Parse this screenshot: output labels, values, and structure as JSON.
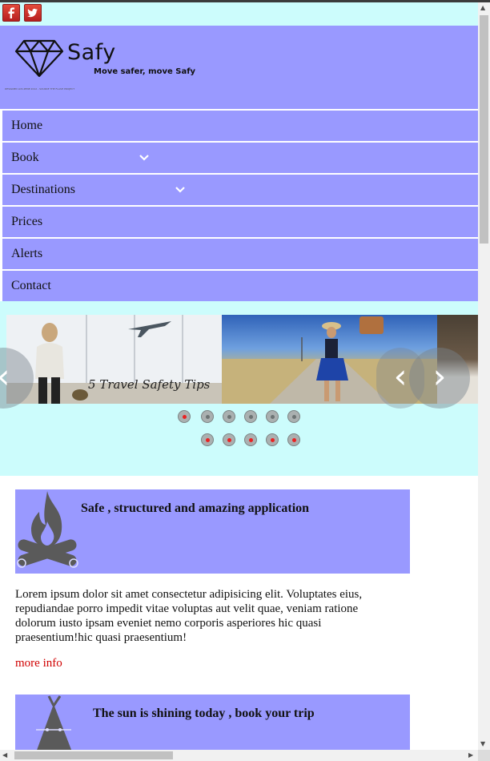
{
  "social": {
    "facebook_icon": "facebook-icon",
    "twitter_icon": "twitter-icon"
  },
  "header": {
    "logo_icon": "diamond-icon",
    "title": "Safy",
    "tagline": "Move safer, move Safy",
    "credit": "DESIGNED LOS ZENE 2012 - SOURCE THE FLASH PROJECT"
  },
  "nav": {
    "items": [
      {
        "label": "Home"
      },
      {
        "label": "Book",
        "has_dropdown": true
      },
      {
        "label": "Destinations",
        "has_dropdown": true
      },
      {
        "label": "Prices"
      },
      {
        "label": "Alerts"
      },
      {
        "label": "Contact"
      }
    ]
  },
  "slider": {
    "slides": [
      {
        "caption": "5 Travel Safety Tips"
      },
      {
        "caption": ""
      },
      {
        "caption": ""
      }
    ],
    "prev_label": "‹",
    "next_label": "›",
    "dots_row1": 6,
    "dots_row2": 5
  },
  "sections": [
    {
      "title": "Safe , structured and amazing application",
      "icon": "campfire-icon"
    },
    {
      "title": "The sun is shining today , book your trip",
      "icon": "tent-icon"
    }
  ],
  "body": {
    "paragraph": "Lorem ipsum dolor sit amet consectetur adipisicing elit. Voluptates eius, repudiandae porro impedit vitae voluptas aut velit quae, veniam ratione dolorum iusto ipsam eveniet nemo corporis asperiores hic quasi praesentium!hic quasi praesentium!",
    "more_link": "more info"
  },
  "colors": {
    "accent": "#9999ff",
    "pale": "#ccfcfc",
    "link": "#d00000"
  }
}
